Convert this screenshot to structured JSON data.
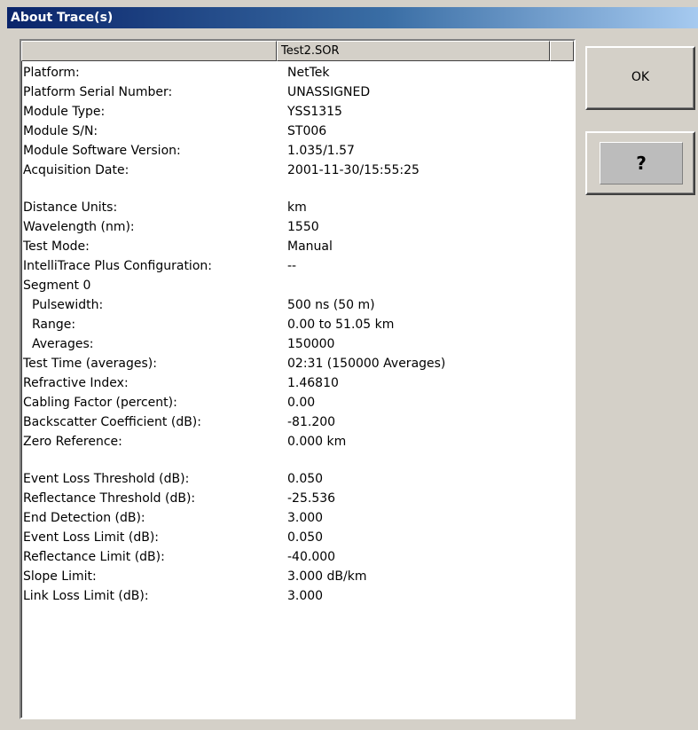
{
  "window": {
    "title": "About Trace(s)"
  },
  "table": {
    "columns": [
      "",
      "Test2.SOR",
      ""
    ],
    "rows": [
      {
        "label": "Platform:",
        "value": "NetTek"
      },
      {
        "label": "Platform Serial Number:",
        "value": "UNASSIGNED"
      },
      {
        "label": "Module Type:",
        "value": "YSS1315"
      },
      {
        "label": "Module S/N:",
        "value": "ST006"
      },
      {
        "label": "Module Software Version:",
        "value": "1.035/1.57"
      },
      {
        "label": "Acquisition Date:",
        "value": "2001-11-30/15:55:25"
      },
      {
        "label": "",
        "value": ""
      },
      {
        "label": "Distance Units:",
        "value": "km"
      },
      {
        "label": "Wavelength (nm):",
        "value": "1550"
      },
      {
        "label": "Test Mode:",
        "value": "Manual"
      },
      {
        "label": "IntelliTrace Plus Configuration:",
        "value": "--"
      },
      {
        "label": "Segment 0",
        "value": ""
      },
      {
        "label": "Pulsewidth:",
        "value": "500 ns (50 m)"
      },
      {
        "label": "Range:",
        "value": "0.00 to 51.05 km"
      },
      {
        "label": "Averages:",
        "value": "150000"
      },
      {
        "label": "Test Time (averages):",
        "value": "02:31 (150000 Averages)"
      },
      {
        "label": "Refractive Index:",
        "value": "1.46810"
      },
      {
        "label": "Cabling Factor (percent):",
        "value": "0.00"
      },
      {
        "label": "Backscatter Coefficient (dB):",
        "value": "-81.200"
      },
      {
        "label": "Zero Reference:",
        "value": "0.000 km"
      },
      {
        "label": "",
        "value": ""
      },
      {
        "label": "Event Loss Threshold (dB):",
        "value": "0.050"
      },
      {
        "label": "Reflectance Threshold (dB):",
        "value": "-25.536"
      },
      {
        "label": "End Detection (dB):",
        "value": "3.000"
      },
      {
        "label": "Event Loss Limit (dB):",
        "value": "0.050"
      },
      {
        "label": "Reflectance Limit (dB):",
        "value": "-40.000"
      },
      {
        "label": "Slope Limit:",
        "value": "3.000 dB/km"
      },
      {
        "label": "Link Loss Limit (dB):",
        "value": "3.000"
      }
    ]
  },
  "buttons": {
    "ok_label": "OK",
    "help_label": "?"
  }
}
